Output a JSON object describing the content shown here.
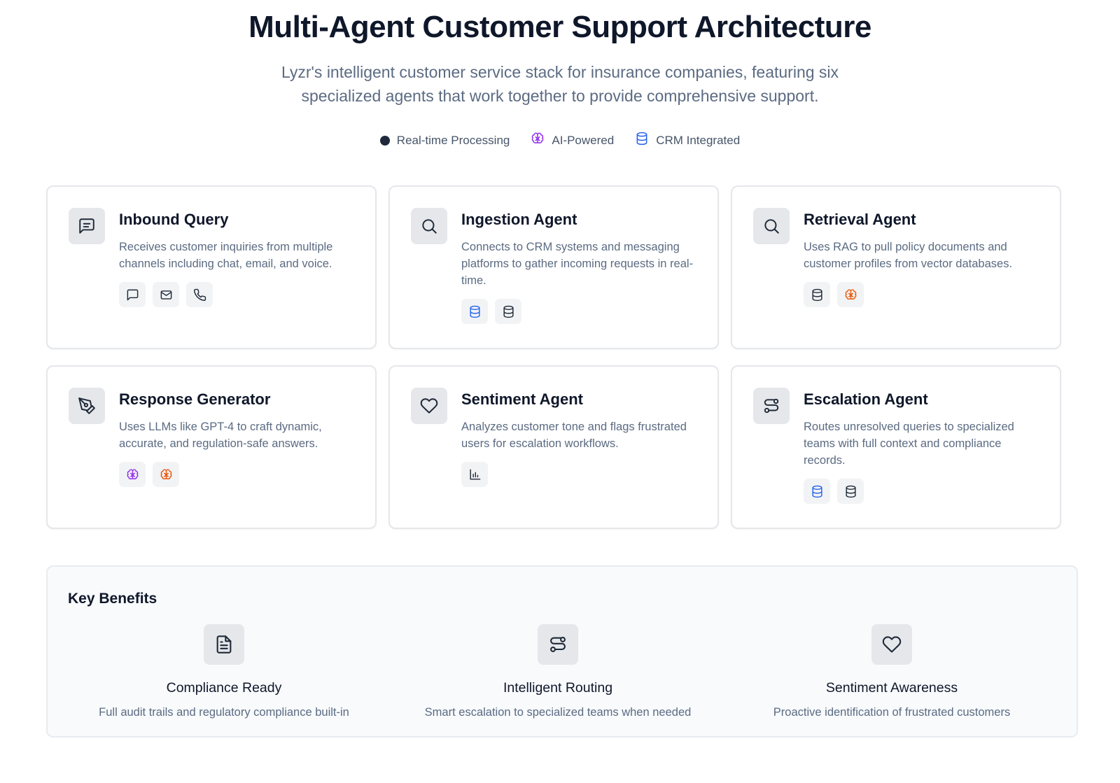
{
  "header": {
    "title": "Multi-Agent Customer Support Architecture",
    "subtitle": "Lyzr's intelligent customer service stack for insurance companies, featuring six specialized agents that work together to provide comprehensive support."
  },
  "legend": [
    {
      "label": "Real-time Processing",
      "icon": "dot-icon"
    },
    {
      "label": "AI-Powered",
      "icon": "brain-icon",
      "color": "#9333ea"
    },
    {
      "label": "CRM Integrated",
      "icon": "database-icon",
      "color": "#2563eb"
    }
  ],
  "agents": [
    {
      "title": "Inbound Query",
      "description": "Receives customer inquiries from multiple channels including chat, email, and voice.",
      "icon": "message-square-icon",
      "chips": [
        "chat-icon",
        "mail-icon",
        "phone-icon"
      ]
    },
    {
      "title": "Ingestion Agent",
      "description": "Connects to CRM systems and messaging platforms to gather incoming requests in real-time.",
      "icon": "search-icon",
      "chips": [
        "database-blue-icon",
        "database-icon"
      ]
    },
    {
      "title": "Retrieval Agent",
      "description": "Uses RAG to pull policy documents and customer profiles from vector databases.",
      "icon": "search-icon",
      "chips": [
        "database-icon",
        "brain-orange-icon"
      ]
    },
    {
      "title": "Response Generator",
      "description": "Uses LLMs like GPT-4 to craft dynamic, accurate, and regulation-safe answers.",
      "icon": "pen-tool-icon",
      "chips": [
        "brain-purple-icon",
        "brain-orange-icon"
      ]
    },
    {
      "title": "Sentiment Agent",
      "description": "Analyzes customer tone and flags frustrated users for escalation workflows.",
      "icon": "heart-icon",
      "chips": [
        "bar-chart-icon"
      ]
    },
    {
      "title": "Escalation Agent",
      "description": "Routes unresolved queries to specialized teams with full context and compliance records.",
      "icon": "route-icon",
      "chips": [
        "database-blue-icon",
        "database-icon"
      ]
    }
  ],
  "benefits": {
    "title": "Key Benefits",
    "items": [
      {
        "title": "Compliance Ready",
        "description": "Full audit trails and regulatory compliance built-in",
        "icon": "file-text-icon"
      },
      {
        "title": "Intelligent Routing",
        "description": "Smart escalation to specialized teams when needed",
        "icon": "route-icon"
      },
      {
        "title": "Sentiment Awareness",
        "description": "Proactive identification of frustrated customers",
        "icon": "heart-icon"
      }
    ]
  },
  "colors": {
    "brain_purple": "#9333ea",
    "brain_orange": "#ea580c",
    "database_blue": "#2563eb",
    "icon_dark": "#1f2937"
  }
}
